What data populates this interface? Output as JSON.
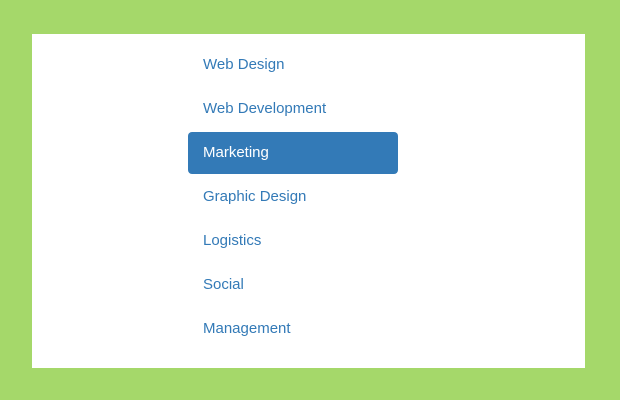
{
  "colors": {
    "page_background": "#a5d86a",
    "panel_background": "#ffffff",
    "link": "#337ab7",
    "active_background": "#337ab7",
    "active_text": "#ffffff"
  },
  "nav": {
    "active_index": 2,
    "items": [
      {
        "label": "Web Design"
      },
      {
        "label": "Web Development"
      },
      {
        "label": "Marketing"
      },
      {
        "label": "Graphic Design"
      },
      {
        "label": "Logistics"
      },
      {
        "label": "Social"
      },
      {
        "label": "Management"
      }
    ]
  }
}
